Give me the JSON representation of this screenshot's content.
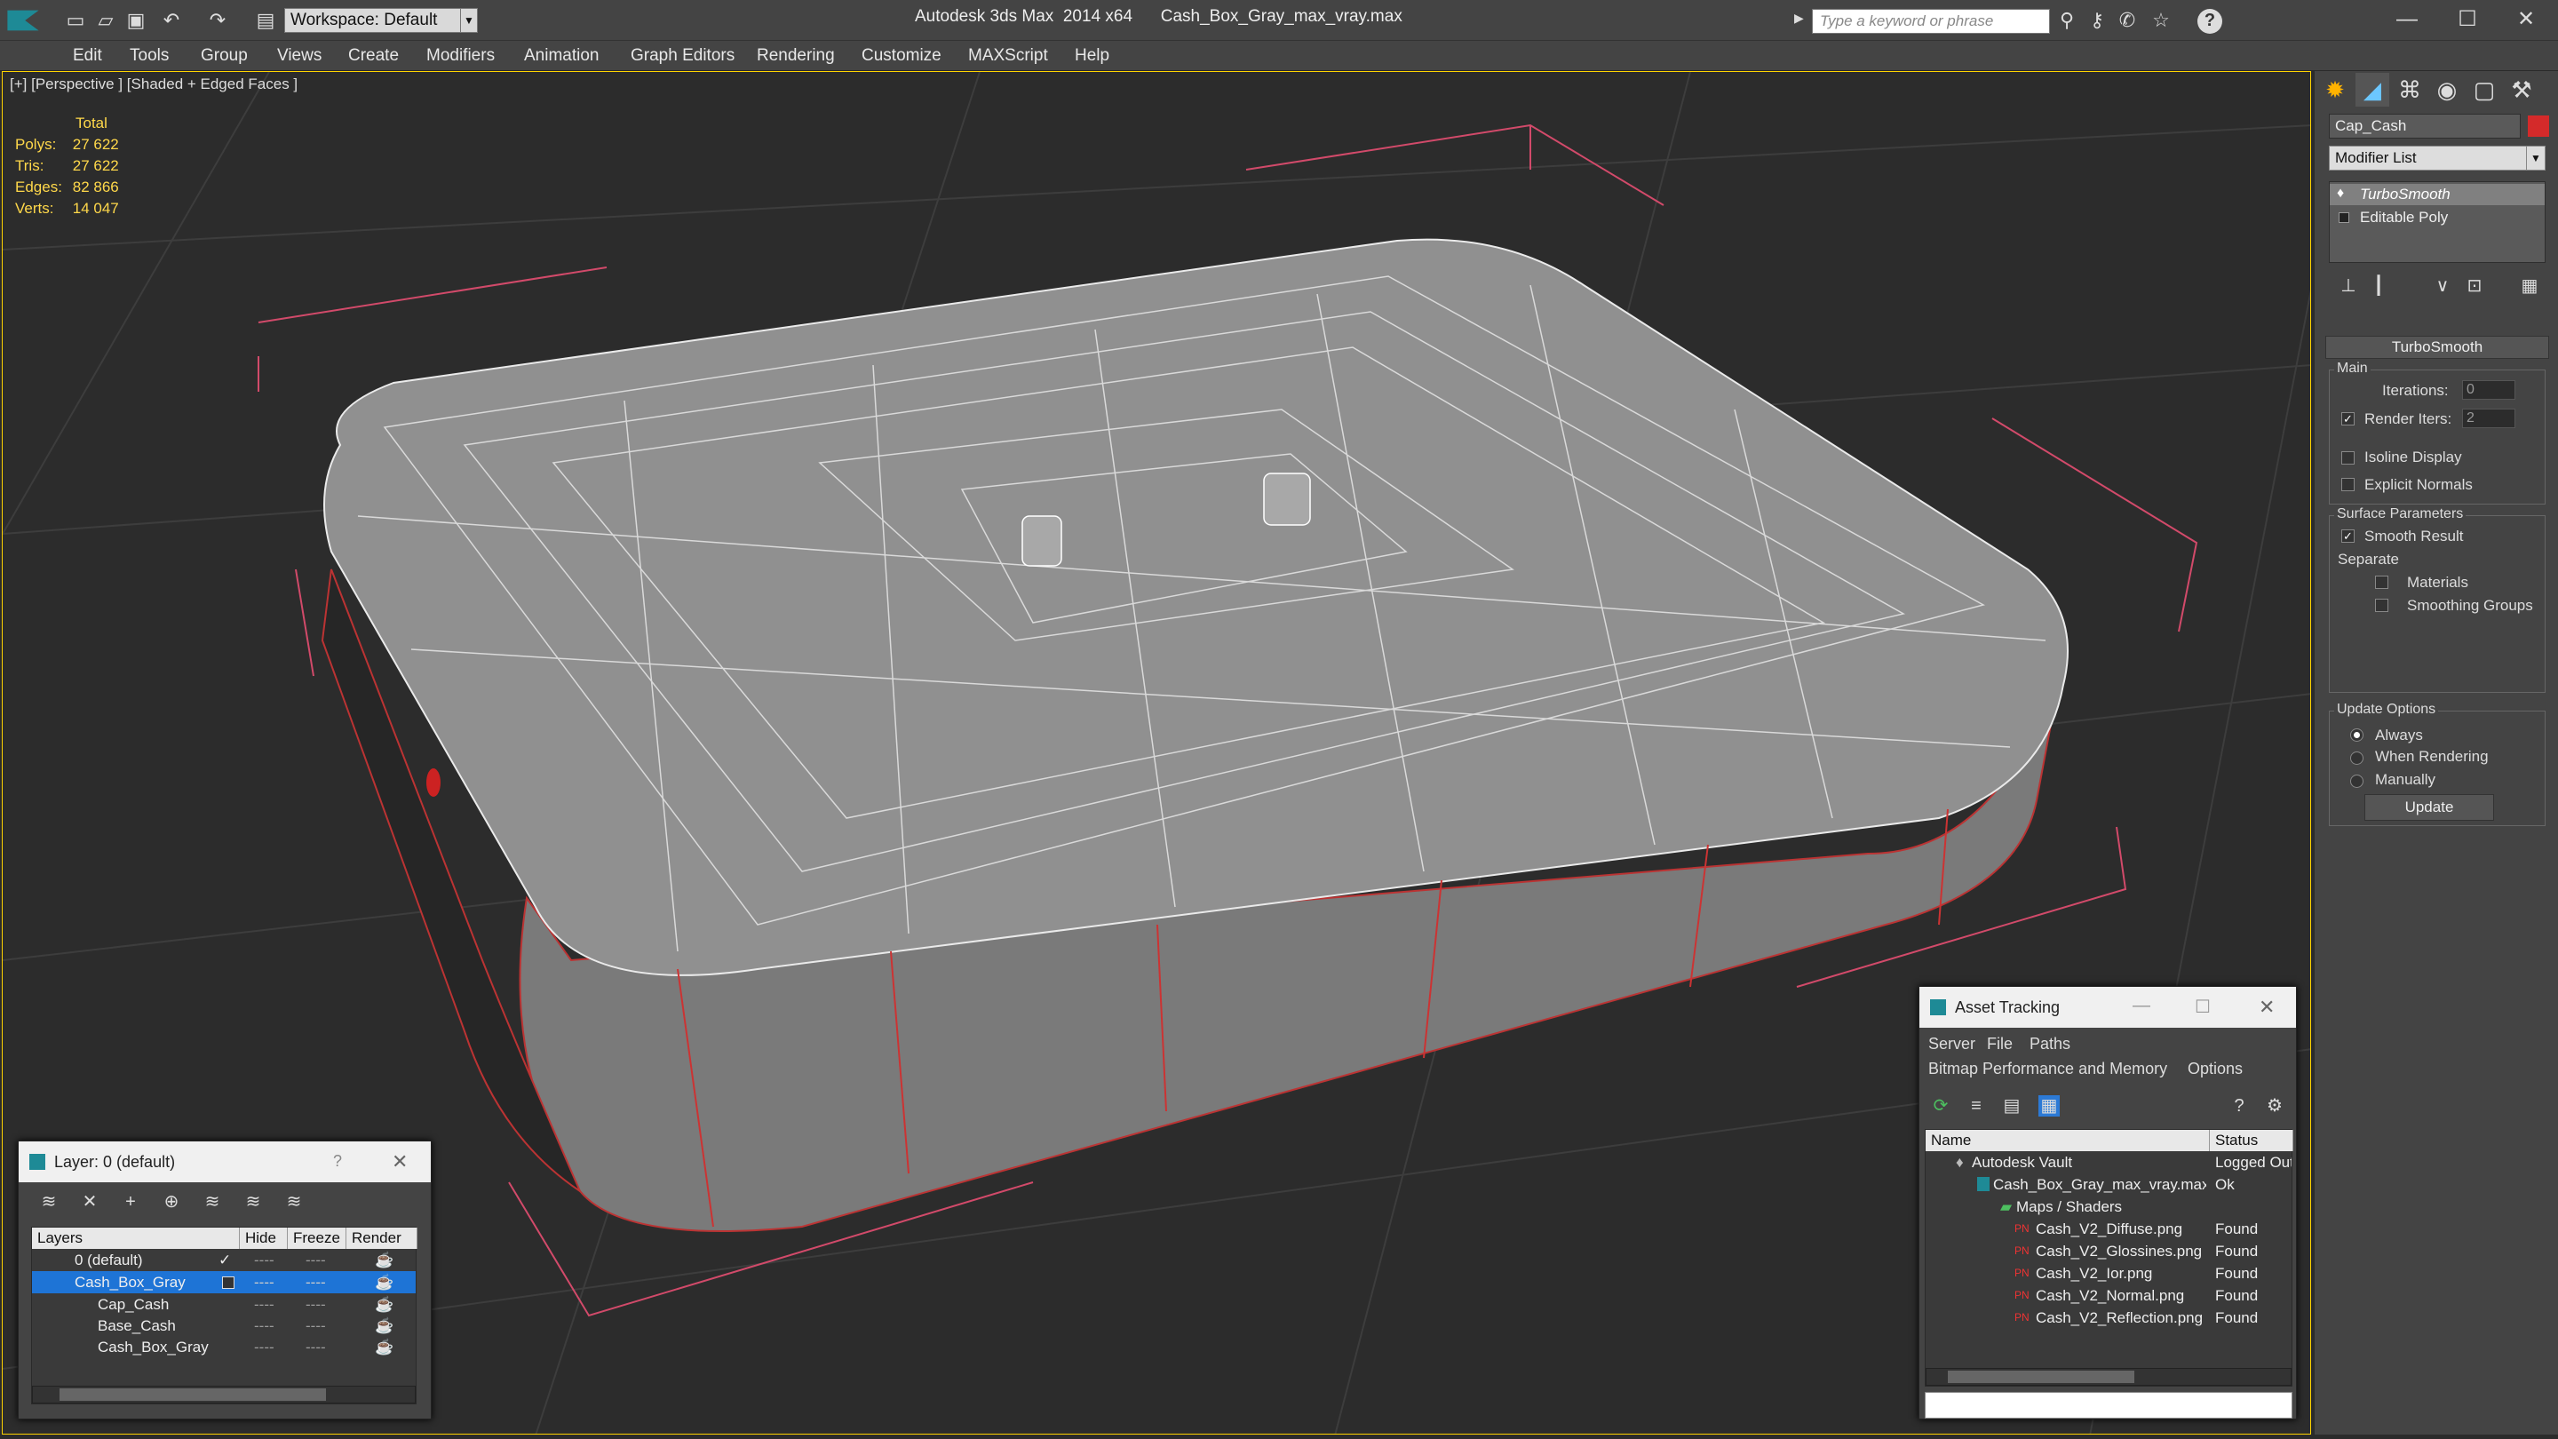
{
  "app": {
    "title": "Autodesk 3ds Max  2014 x64",
    "file": "Cash_Box_Gray_max_vray.max",
    "workspace": "Workspace: Default",
    "search_placeholder": "Type a keyword or phrase",
    "menus": [
      "Edit",
      "Tools",
      "Group",
      "Views",
      "Create",
      "Modifiers",
      "Animation",
      "Graph Editors",
      "Rendering",
      "Customize",
      "MAXScript",
      "Help"
    ]
  },
  "viewport": {
    "label": "[+] [Perspective ] [Shaded + Edged Faces ]",
    "stats": {
      "header": "Total",
      "rows": [
        {
          "label": "Polys:",
          "value": "27 622"
        },
        {
          "label": "Tris:",
          "value": "27 622"
        },
        {
          "label": "Edges:",
          "value": "82 866"
        },
        {
          "label": "Verts:",
          "value": "14 047"
        }
      ]
    }
  },
  "command_panel": {
    "object_name": "Cap_Cash",
    "modifier_list": "Modifier List",
    "stack": [
      "TurboSmooth",
      "Editable Poly"
    ],
    "rollout": "TurboSmooth",
    "main_group": "Main",
    "iterations_label": "Iterations:",
    "iterations_value": "0",
    "render_iters_label": "Render Iters:",
    "render_iters_value": "2",
    "isoline": "Isoline Display",
    "explicit_normals": "Explicit Normals",
    "surface_group": "Surface Parameters",
    "smooth_result": "Smooth Result",
    "separate": "Separate",
    "materials": "Materials",
    "smoothing_groups": "Smoothing Groups",
    "update_group": "Update Options",
    "always": "Always",
    "when_rendering": "When Rendering",
    "manually": "Manually",
    "update_button": "Update",
    "accent": "#d42a2a"
  },
  "layer_panel": {
    "title": "Layer: 0 (default)",
    "help": "?",
    "columns": [
      "Layers",
      "Hide",
      "Freeze",
      "Render"
    ],
    "rows": [
      {
        "name": "0 (default)",
        "check": "✓"
      },
      {
        "name": "Cash_Box_Gray",
        "check": ""
      },
      {
        "name": "Cap_Cash",
        "check": ""
      },
      {
        "name": "Base_Cash",
        "check": ""
      },
      {
        "name": "Cash_Box_Gray",
        "check": ""
      }
    ],
    "dash": "----"
  },
  "asset_panel": {
    "title": "Asset Tracking",
    "menu": [
      "Server",
      "File",
      "Paths"
    ],
    "menu2": [
      "Bitmap Performance and Memory",
      "Options"
    ],
    "columns": [
      "Name",
      "Status"
    ],
    "rows": [
      {
        "name": "Autodesk Vault",
        "status": "Logged Out"
      },
      {
        "name": "Cash_Box_Gray_max_vray.max",
        "status": "Ok"
      },
      {
        "name": "Maps / Shaders",
        "status": ""
      },
      {
        "name": "Cash_V2_Diffuse.png",
        "status": "Found"
      },
      {
        "name": "Cash_V2_Glossines.png",
        "status": "Found"
      },
      {
        "name": "Cash_V2_Ior.png",
        "status": "Found"
      },
      {
        "name": "Cash_V2_Normal.png",
        "status": "Found"
      },
      {
        "name": "Cash_V2_Reflection.png",
        "status": "Found"
      }
    ]
  }
}
